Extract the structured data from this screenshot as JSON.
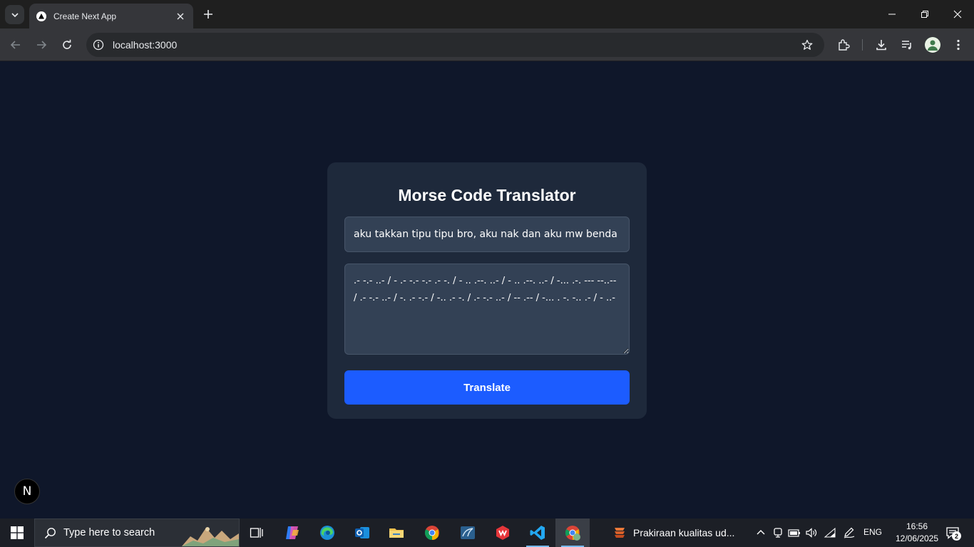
{
  "browser": {
    "tab_title": "Create Next App",
    "url": "localhost:3000"
  },
  "app": {
    "title": "Morse Code Translator",
    "input_value": "aku takkan tipu tipu bro, aku nak dan aku mw benda",
    "output_value": ".- -.- ..- / - .- -.- -.- .- -. / - .. .--. ..- / - .. .--. ..- / -... .-. --- --..-- / .- -.- ..- / -. .- -.- / -.. .- -. / .- -.- ..- / -- .-- / -... . -. -.. .- / - ..-",
    "translate_label": "Translate",
    "next_badge": "N"
  },
  "taskbar": {
    "search_placeholder": "Type here to search",
    "running_app_label": "Prakiraan kualitas ud...",
    "language": "ENG",
    "time": "16:56",
    "date": "12/06/2025",
    "notification_count": "2"
  },
  "colors": {
    "page_background": "#0f172a",
    "card_background": "#1e293b",
    "field_background": "#334155",
    "button_blue": "#1c5cff"
  }
}
